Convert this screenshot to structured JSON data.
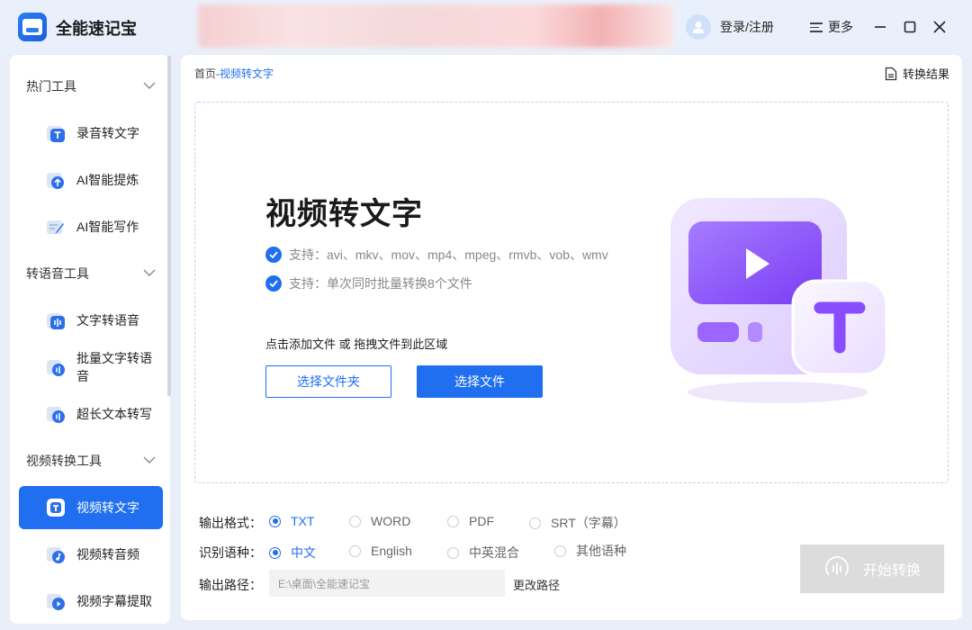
{
  "app": {
    "title": "全能速记宝"
  },
  "header": {
    "login_label": "登录/注册",
    "more_label": "更多"
  },
  "sidebar": {
    "groups": [
      {
        "title": "热门工具",
        "items": [
          {
            "label": "录音转文字",
            "icon": "audio-to-text-icon"
          },
          {
            "label": "AI智能提炼",
            "icon": "ai-extract-icon"
          },
          {
            "label": "AI智能写作",
            "icon": "ai-write-icon"
          }
        ]
      },
      {
        "title": "转语音工具",
        "items": [
          {
            "label": "文字转语音",
            "icon": "text-to-speech-icon"
          },
          {
            "label": "批量文字转语音",
            "icon": "batch-text-to-speech-icon"
          },
          {
            "label": "超长文本转写",
            "icon": "long-text-icon"
          }
        ]
      },
      {
        "title": "视频转换工具",
        "items": [
          {
            "label": "视频转文字",
            "icon": "video-to-text-icon",
            "active": true
          },
          {
            "label": "视频转音频",
            "icon": "video-to-audio-icon"
          },
          {
            "label": "视频字幕提取",
            "icon": "subtitle-extract-icon"
          }
        ]
      }
    ]
  },
  "main": {
    "breadcrumb": {
      "home": "首页",
      "separator": "-",
      "current": "视频转文字"
    },
    "result_label": "转换结果",
    "title": "视频转文字",
    "support": [
      "支持：avi、mkv、mov、mp4、mpeg、rmvb、vob、wmv",
      "支持：单次同时批量转换8个文件"
    ],
    "hint": "点击添加文件 或 拖拽文件到此区域",
    "select_folder_label": "选择文件夹",
    "select_file_label": "选择文件",
    "output_format": {
      "label": "输出格式：",
      "options": [
        "TXT",
        "WORD",
        "PDF",
        "SRT（字幕）"
      ],
      "selected": "TXT"
    },
    "language": {
      "label": "识别语种：",
      "options": [
        "中文",
        "English",
        "中英混合",
        "其他语种"
      ],
      "selected": "中文"
    },
    "output_path": {
      "label": "输出路径：",
      "value": "E:\\桌面\\全能速记宝",
      "change_label": "更改路径"
    },
    "start_label": "开始转换"
  },
  "colors": {
    "accent": "#1f6ff0",
    "disabled": "#dcdcdc"
  }
}
